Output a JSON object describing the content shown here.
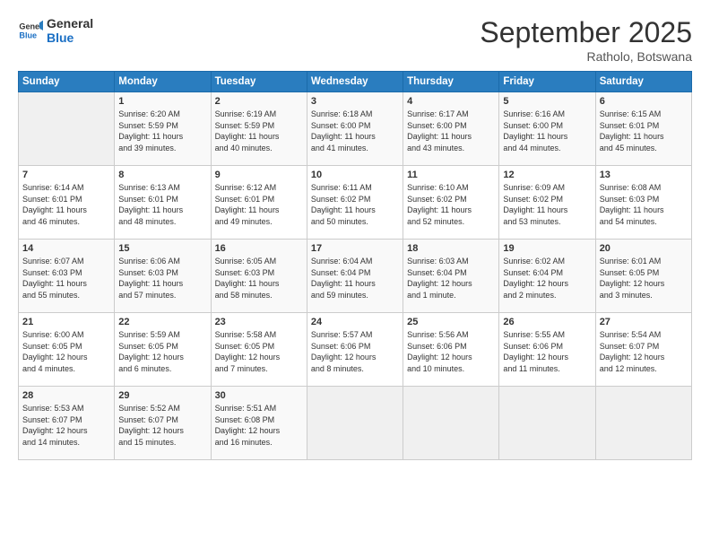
{
  "header": {
    "logo_line1": "General",
    "logo_line2": "Blue",
    "month": "September 2025",
    "location": "Ratholo, Botswana"
  },
  "days_of_week": [
    "Sunday",
    "Monday",
    "Tuesday",
    "Wednesday",
    "Thursday",
    "Friday",
    "Saturday"
  ],
  "weeks": [
    [
      {
        "day": "",
        "info": ""
      },
      {
        "day": "1",
        "info": "Sunrise: 6:20 AM\nSunset: 5:59 PM\nDaylight: 11 hours\nand 39 minutes."
      },
      {
        "day": "2",
        "info": "Sunrise: 6:19 AM\nSunset: 5:59 PM\nDaylight: 11 hours\nand 40 minutes."
      },
      {
        "day": "3",
        "info": "Sunrise: 6:18 AM\nSunset: 6:00 PM\nDaylight: 11 hours\nand 41 minutes."
      },
      {
        "day": "4",
        "info": "Sunrise: 6:17 AM\nSunset: 6:00 PM\nDaylight: 11 hours\nand 43 minutes."
      },
      {
        "day": "5",
        "info": "Sunrise: 6:16 AM\nSunset: 6:00 PM\nDaylight: 11 hours\nand 44 minutes."
      },
      {
        "day": "6",
        "info": "Sunrise: 6:15 AM\nSunset: 6:01 PM\nDaylight: 11 hours\nand 45 minutes."
      }
    ],
    [
      {
        "day": "7",
        "info": "Sunrise: 6:14 AM\nSunset: 6:01 PM\nDaylight: 11 hours\nand 46 minutes."
      },
      {
        "day": "8",
        "info": "Sunrise: 6:13 AM\nSunset: 6:01 PM\nDaylight: 11 hours\nand 48 minutes."
      },
      {
        "day": "9",
        "info": "Sunrise: 6:12 AM\nSunset: 6:01 PM\nDaylight: 11 hours\nand 49 minutes."
      },
      {
        "day": "10",
        "info": "Sunrise: 6:11 AM\nSunset: 6:02 PM\nDaylight: 11 hours\nand 50 minutes."
      },
      {
        "day": "11",
        "info": "Sunrise: 6:10 AM\nSunset: 6:02 PM\nDaylight: 11 hours\nand 52 minutes."
      },
      {
        "day": "12",
        "info": "Sunrise: 6:09 AM\nSunset: 6:02 PM\nDaylight: 11 hours\nand 53 minutes."
      },
      {
        "day": "13",
        "info": "Sunrise: 6:08 AM\nSunset: 6:03 PM\nDaylight: 11 hours\nand 54 minutes."
      }
    ],
    [
      {
        "day": "14",
        "info": "Sunrise: 6:07 AM\nSunset: 6:03 PM\nDaylight: 11 hours\nand 55 minutes."
      },
      {
        "day": "15",
        "info": "Sunrise: 6:06 AM\nSunset: 6:03 PM\nDaylight: 11 hours\nand 57 minutes."
      },
      {
        "day": "16",
        "info": "Sunrise: 6:05 AM\nSunset: 6:03 PM\nDaylight: 11 hours\nand 58 minutes."
      },
      {
        "day": "17",
        "info": "Sunrise: 6:04 AM\nSunset: 6:04 PM\nDaylight: 11 hours\nand 59 minutes."
      },
      {
        "day": "18",
        "info": "Sunrise: 6:03 AM\nSunset: 6:04 PM\nDaylight: 12 hours\nand 1 minute."
      },
      {
        "day": "19",
        "info": "Sunrise: 6:02 AM\nSunset: 6:04 PM\nDaylight: 12 hours\nand 2 minutes."
      },
      {
        "day": "20",
        "info": "Sunrise: 6:01 AM\nSunset: 6:05 PM\nDaylight: 12 hours\nand 3 minutes."
      }
    ],
    [
      {
        "day": "21",
        "info": "Sunrise: 6:00 AM\nSunset: 6:05 PM\nDaylight: 12 hours\nand 4 minutes."
      },
      {
        "day": "22",
        "info": "Sunrise: 5:59 AM\nSunset: 6:05 PM\nDaylight: 12 hours\nand 6 minutes."
      },
      {
        "day": "23",
        "info": "Sunrise: 5:58 AM\nSunset: 6:05 PM\nDaylight: 12 hours\nand 7 minutes."
      },
      {
        "day": "24",
        "info": "Sunrise: 5:57 AM\nSunset: 6:06 PM\nDaylight: 12 hours\nand 8 minutes."
      },
      {
        "day": "25",
        "info": "Sunrise: 5:56 AM\nSunset: 6:06 PM\nDaylight: 12 hours\nand 10 minutes."
      },
      {
        "day": "26",
        "info": "Sunrise: 5:55 AM\nSunset: 6:06 PM\nDaylight: 12 hours\nand 11 minutes."
      },
      {
        "day": "27",
        "info": "Sunrise: 5:54 AM\nSunset: 6:07 PM\nDaylight: 12 hours\nand 12 minutes."
      }
    ],
    [
      {
        "day": "28",
        "info": "Sunrise: 5:53 AM\nSunset: 6:07 PM\nDaylight: 12 hours\nand 14 minutes."
      },
      {
        "day": "29",
        "info": "Sunrise: 5:52 AM\nSunset: 6:07 PM\nDaylight: 12 hours\nand 15 minutes."
      },
      {
        "day": "30",
        "info": "Sunrise: 5:51 AM\nSunset: 6:08 PM\nDaylight: 12 hours\nand 16 minutes."
      },
      {
        "day": "",
        "info": ""
      },
      {
        "day": "",
        "info": ""
      },
      {
        "day": "",
        "info": ""
      },
      {
        "day": "",
        "info": ""
      }
    ]
  ]
}
